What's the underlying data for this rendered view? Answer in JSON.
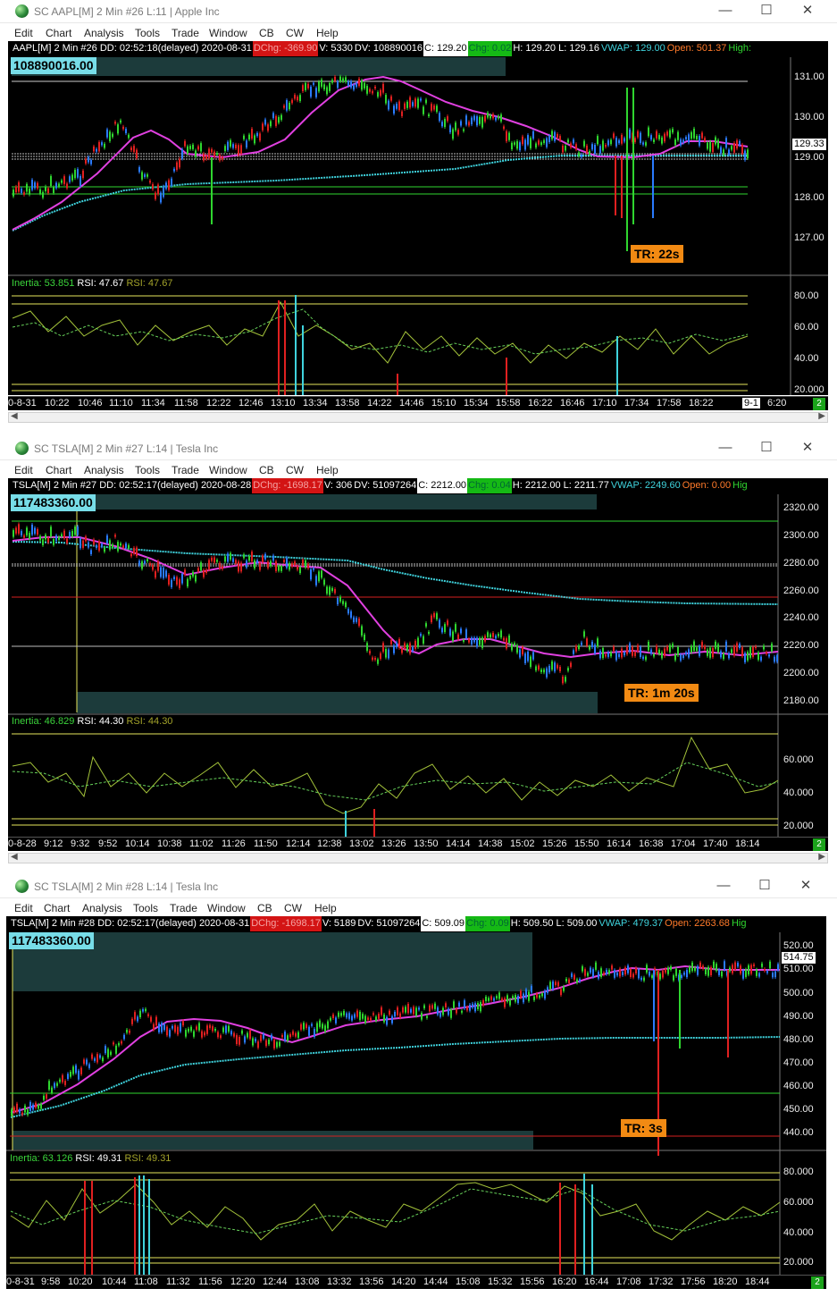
{
  "windows": [
    {
      "title": "SC AAPL[M]  2 Min   #26  L:11 | Apple Inc",
      "menu": [
        "Edit",
        "Chart",
        "Analysis",
        "Tools",
        "Trade",
        "Window",
        "CB",
        "CW",
        "Help"
      ],
      "info": {
        "header": "AAPL[M]  2 Min   #26 DD: 02:52:18(delayed) 2020-08-31",
        "dchg": "DChg: -369.90",
        "v": "V: 5330",
        "dv": "DV: 108890016",
        "c": "C: 129.20",
        "chg": "Chg: 0.02",
        "hl": "H: 129.20  L: 129.16",
        "vwap": "VWAP: 129.00",
        "open": "Open: 501.37",
        "high": "High:"
      },
      "dv_badge": "108890016.00",
      "tr_label": "TR: 22s",
      "price_ticks": [
        "131.00",
        "130.00",
        "129.00",
        "128.00",
        "127.00"
      ],
      "last_price": "129.33",
      "rsi": {
        "inertia": "Inertia: 53.851",
        "rsi1": "RSI: 47.67",
        "rsi2": "RSI: 47.67"
      },
      "rsi_ticks": [
        "80.00",
        "60.00",
        "40.00",
        "20.000"
      ],
      "time_start": "0-8-31",
      "time_ticks": [
        "10:22",
        "10:46",
        "11:10",
        "11:34",
        "11:58",
        "12:22",
        "12:46",
        "13:10",
        "13:34",
        "13:58",
        "14:22",
        "14:46",
        "15:10",
        "15:34",
        "15:58",
        "16:22",
        "16:46",
        "17:10",
        "17:34",
        "17:58",
        "18:22"
      ],
      "time_end_box": "9-1",
      "time_end": "6:20",
      "badge": "2",
      "colors": {
        "ma": "#e040e0",
        "vwap": "#3fd3dd"
      }
    },
    {
      "title": "SC TSLA[M]  2 Min   #27  L:14 | Tesla Inc",
      "menu": [
        "Edit",
        "Chart",
        "Analysis",
        "Tools",
        "Trade",
        "Window",
        "CB",
        "CW",
        "Help"
      ],
      "info": {
        "header": "TSLA[M]  2 Min   #27 DD: 02:52:17(delayed) 2020-08-28",
        "dchg": "DChg: -1698.17",
        "v": "V: 306",
        "dv": "DV: 51097264",
        "c": "C: 2212.00",
        "chg": "Chg: 0.04",
        "hl": "H: 2212.00  L: 2211.77",
        "vwap": "VWAP: 2249.60",
        "open": "Open: 0.00",
        "high": "Hig"
      },
      "dv_badge": "117483360.00",
      "tr_label": "TR: 1m 20s",
      "price_ticks": [
        "2320.00",
        "2300.00",
        "2280.00",
        "2260.00",
        "2240.00",
        "2220.00",
        "2200.00",
        "2180.00"
      ],
      "last_price": "",
      "rsi": {
        "inertia": "Inertia: 46.829",
        "rsi1": "RSI: 44.30",
        "rsi2": "RSI: 44.30"
      },
      "rsi_ticks": [
        "60.000",
        "40.000",
        "20.000"
      ],
      "time_start": "0-8-28",
      "time_ticks": [
        "9:12",
        "9:32",
        "9:52",
        "10:14",
        "10:38",
        "11:02",
        "11:26",
        "11:50",
        "12:14",
        "12:38",
        "13:02",
        "13:26",
        "13:50",
        "14:14",
        "14:38",
        "15:02",
        "15:26",
        "15:50",
        "16:14",
        "16:38",
        "17:04",
        "17:40",
        "18:14"
      ],
      "time_end_box": "",
      "time_end": "",
      "badge": "2",
      "colors": {
        "ma": "#e040e0",
        "vwap": "#3fd3dd"
      }
    },
    {
      "title": "SC TSLA[M]  2 Min   #28  L:14 | Tesla Inc",
      "menu": [
        "Edit",
        "Chart",
        "Analysis",
        "Tools",
        "Trade",
        "Window",
        "CB",
        "CW",
        "Help"
      ],
      "info": {
        "header": "TSLA[M]  2 Min   #28 DD: 02:52:17(delayed) 2020-08-31",
        "dchg": "DChg: -1698.17",
        "v": "V: 5189",
        "dv": "DV: 51097264",
        "c": "C: 509.09",
        "chg": "Chg: 0.09",
        "hl": "H: 509.50  L: 509.00",
        "vwap": "VWAP: 479.37",
        "open": "Open: 2263.68",
        "high": "Hig"
      },
      "dv_badge": "117483360.00",
      "tr_label": "TR: 3s",
      "price_ticks": [
        "520.00",
        "510.00",
        "500.00",
        "490.00",
        "480.00",
        "470.00",
        "460.00",
        "450.00",
        "440.00"
      ],
      "last_price": "514.75",
      "rsi": {
        "inertia": "Inertia: 63.126",
        "rsi1": "RSI: 49.31",
        "rsi2": "RSI: 49.31"
      },
      "rsi_ticks": [
        "80.000",
        "60.000",
        "40.000",
        "20.000"
      ],
      "time_start": "0-8-31",
      "time_ticks": [
        "9:58",
        "10:20",
        "10:44",
        "11:08",
        "11:32",
        "11:56",
        "12:20",
        "12:44",
        "13:08",
        "13:32",
        "13:56",
        "14:20",
        "14:44",
        "15:08",
        "15:32",
        "15:56",
        "16:20",
        "16:44",
        "17:08",
        "17:32",
        "17:56",
        "18:20",
        "18:44"
      ],
      "time_end_box": "",
      "time_end": "",
      "badge": "2",
      "colors": {
        "ma": "#e040e0",
        "vwap": "#3fd3dd"
      }
    }
  ]
}
